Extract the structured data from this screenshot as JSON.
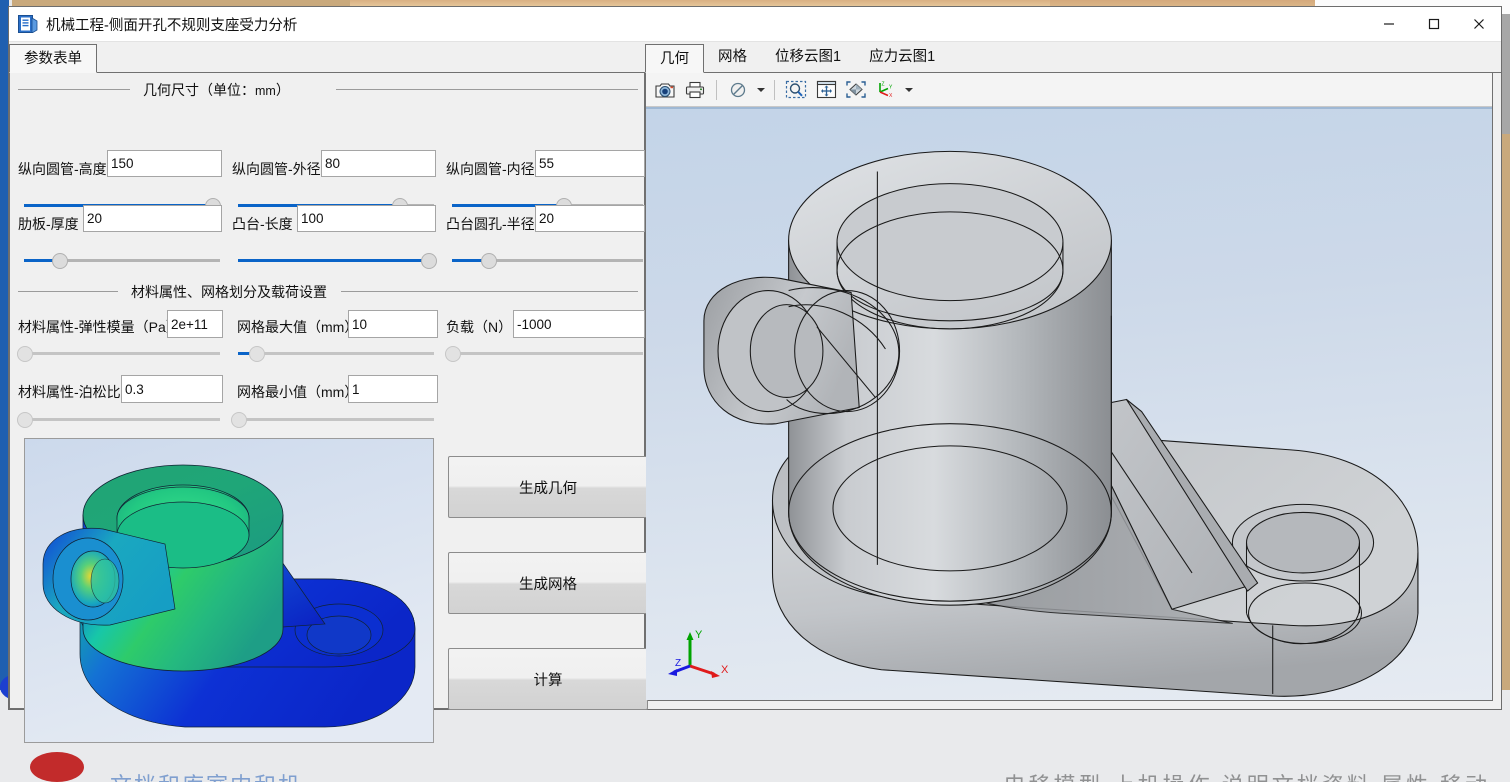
{
  "window": {
    "title": "机械工程-侧面开孔不规则支座受力分析",
    "app_icon": "app-document-icon",
    "minimize": "—",
    "maximize": "☐",
    "close": "✕"
  },
  "left_panel": {
    "tab_label": "参数表单",
    "geometry_group": {
      "legend_main": "几何尺寸（单位：",
      "legend_unit": "mm",
      "legend_tail": "）",
      "fields": [
        {
          "label": "纵向圆管-高度",
          "value": "150",
          "slider_pct": 96
        },
        {
          "label": "纵向圆管-外径",
          "value": "80",
          "slider_pct": 82
        },
        {
          "label": "纵向圆管-内径",
          "value": "55",
          "slider_pct": 58
        },
        {
          "label": "肋板-厚度",
          "value": "20",
          "slider_pct": 18
        },
        {
          "label": "凸台-长度",
          "value": "100",
          "slider_pct": 97
        },
        {
          "label": "凸台圆孔-半径",
          "value": "20",
          "slider_pct": 19
        }
      ]
    },
    "material_group": {
      "legend": "材料属性、网格划分及载荷设置",
      "fields": [
        {
          "label": "材料属性-弹性模量（Pa）",
          "value": "2e+11",
          "slider_pct": 0
        },
        {
          "label": "网格最大值（mm）",
          "value": "10",
          "slider_pct": 9
        },
        {
          "label": "负载（N）",
          "value": "-1000",
          "slider_pct": 0
        },
        {
          "label": "材料属性-泊松比",
          "value": "0.3",
          "slider_pct": 0
        },
        {
          "label": "网格最小值（mm）",
          "value": "1",
          "slider_pct": 0
        }
      ]
    },
    "buttons": [
      {
        "label": "生成几何"
      },
      {
        "label": "生成网格"
      },
      {
        "label": "计算"
      }
    ],
    "preview": {
      "name": "stress-contour-preview",
      "description": "应力云图预览"
    }
  },
  "right_panel": {
    "tabs": [
      {
        "label": "几何",
        "active": true
      },
      {
        "label": "网格",
        "active": false
      },
      {
        "label": "位移云图1",
        "active": false
      },
      {
        "label": "应力云图1",
        "active": false
      }
    ],
    "toolbar": [
      {
        "name": "screenshot-camera-icon"
      },
      {
        "name": "print-icon"
      },
      {
        "name": "no-selection-icon",
        "caret": true
      },
      {
        "name": "box-zoom-icon"
      },
      {
        "name": "pan-fit-icon"
      },
      {
        "name": "fit-view-icon"
      },
      {
        "name": "view-orientation-icon",
        "caret": true
      }
    ],
    "axis_triad": {
      "x": "X",
      "y": "Y",
      "z": "Z",
      "x_color": "#e01b1b",
      "y_color": "#00a400",
      "z_color": "#1a1ae0"
    },
    "viewport": {
      "name": "geometry-3d-viewport",
      "model": "侧面开孔不规则支座"
    }
  },
  "colors": {
    "accent": "#0a64c8",
    "window_bg": "#f0f0f0",
    "border": "#707070",
    "title_bg": "#ffffff"
  },
  "background": {
    "strip_text_left": "文档和库室内和机",
    "strip_text_right": "电移模型 上机操作 说明文档资料 属性 移动"
  }
}
